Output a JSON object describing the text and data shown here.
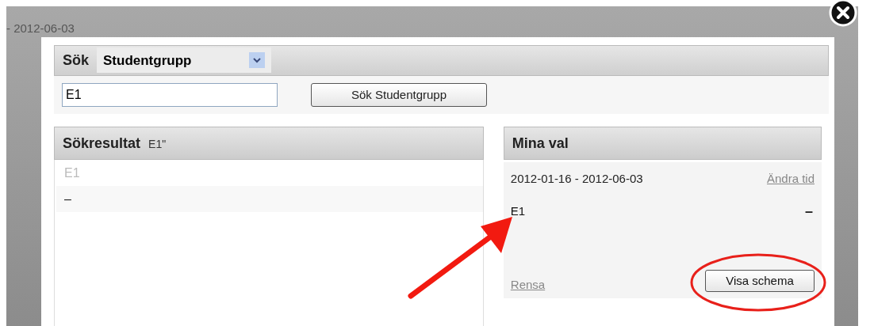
{
  "background": {
    "date_text": "- 2012-06-03"
  },
  "search": {
    "label": "Sök",
    "type_select": "Studentgrupp",
    "query": "E1",
    "button": "Sök Studentgrupp"
  },
  "results": {
    "title": "Sökresultat",
    "query_echo": "E1\"",
    "items": [
      {
        "label": "E1",
        "disabled": true
      },
      {
        "label": "–",
        "disabled": false
      }
    ]
  },
  "choices": {
    "title": "Mina val",
    "date_range": "2012-01-16 - 2012-06-03",
    "change_link": "Ändra tid",
    "items": [
      {
        "label": "E1",
        "remove": "–"
      }
    ],
    "clear_link": "Rensa",
    "show_button": "Visa schema"
  }
}
